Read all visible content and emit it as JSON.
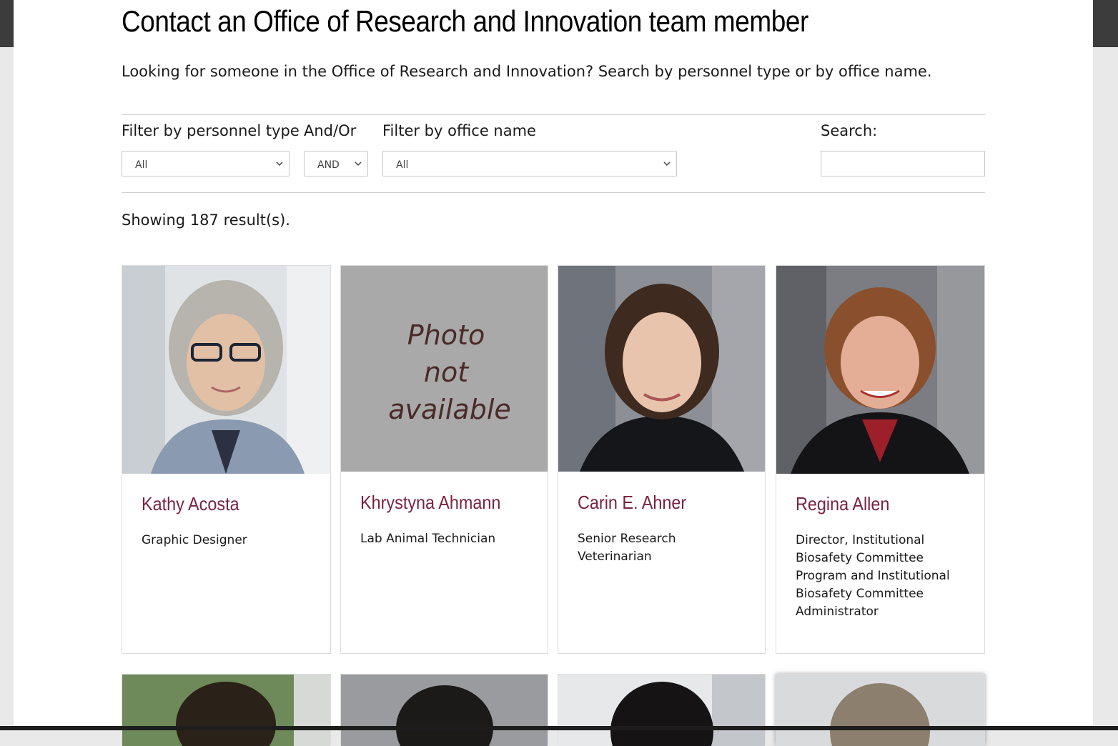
{
  "page": {
    "title": "Contact an Office of Research and Innovation team member",
    "intro": "Looking for someone in the Office of Research and Innovation? Search by personnel type or by office name."
  },
  "filters": {
    "personnel_label": "Filter by personnel type",
    "personnel_value": "All",
    "andor_label": "And/Or",
    "andor_value": "AND",
    "office_label": "Filter by office name",
    "office_value": "All",
    "search_label": "Search:",
    "search_value": ""
  },
  "results_text": "Showing 187 result(s).",
  "placeholder_photo_text": [
    "Photo",
    "not",
    "available"
  ],
  "people": [
    {
      "name": "Kathy Acosta",
      "title": "Graphic Designer"
    },
    {
      "name": "Khrystyna Ahmann",
      "title": "Lab Animal Technician"
    },
    {
      "name": "Carin E. Ahner",
      "title": "Senior Research Veterinarian"
    },
    {
      "name": "Regina Allen",
      "title": "Director, Institutional Biosafety Committee Program and Institutional Biosafety Committee Administrator"
    }
  ],
  "colors": {
    "name_color": "#7a2340",
    "frame_dark": "#3c3c3c"
  }
}
